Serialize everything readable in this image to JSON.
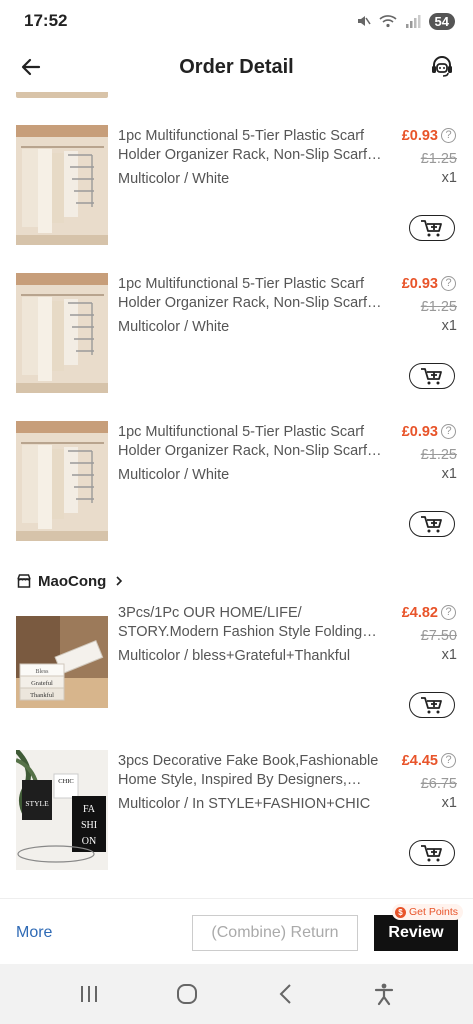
{
  "status_bar": {
    "time": "17:52",
    "battery": "54",
    "icons": [
      "mute-icon",
      "wifi-icon",
      "signal-icon"
    ]
  },
  "header": {
    "title": "Order Detail",
    "back_icon": "arrow-left-icon",
    "support_icon": "customer-service-icon"
  },
  "stores": [
    {
      "name": "MaoCong",
      "icon": "store-icon"
    }
  ],
  "items": [
    {
      "name": "1pc Multifunctional 5-Tier Plastic Scarf Holder Organizer Rack, Non-Slip Scarf Hanger",
      "variant": "Multicolor / White",
      "price": "£0.93",
      "original_price": "£1.25",
      "qty": "x1",
      "thumb": "scarf-rack"
    },
    {
      "name": "1pc Multifunctional 5-Tier Plastic Scarf Holder Organizer Rack, Non-Slip Scarf Hanger",
      "variant": "Multicolor / White",
      "price": "£0.93",
      "original_price": "£1.25",
      "qty": "x1",
      "thumb": "scarf-rack"
    },
    {
      "name": "1pc Multifunctional 5-Tier Plastic Scarf Holder Organizer Rack, Non-Slip Scarf Hanger",
      "variant": "Multicolor / White",
      "price": "£0.93",
      "original_price": "£1.25",
      "qty": "x1",
      "thumb": "scarf-rack"
    },
    {
      "name": "3Pcs/1Pc OUR HOME/LIFE/ STORY.Modern Fashion Style Folding Fake Book",
      "variant": "Multicolor / bless+Grateful+Thankful",
      "price": "£4.82",
      "original_price": "£7.50",
      "qty": "x1",
      "thumb": "books-grateful"
    },
    {
      "name": "3pcs Decorative Fake Book,Fashionable Home Style, Inspired By Designers, Hardcover",
      "variant": "Multicolor / In STYLE+FASHION+CHIC",
      "price": "£4.45",
      "original_price": "£6.75",
      "qty": "x1",
      "thumb": "books-fashion"
    }
  ],
  "thumb_text": {
    "grateful_1": "Bless",
    "grateful_2": "Grateful",
    "grateful_3": "Thankful",
    "fashion_1": "STYLE",
    "fashion_2": "CHIC",
    "fashion_3": "FA",
    "fashion_4": "SHI",
    "fashion_5": "ON"
  },
  "help_glyph": "?",
  "bottom_bar": {
    "more_label": "More",
    "return_label": "(Combine) Return",
    "review_label": "Review",
    "points_label": "Get Points"
  },
  "colors": {
    "accent_price": "#e8542a",
    "link": "#2f6ab5",
    "primary_button": "#111111"
  },
  "nav": [
    "recent-apps-icon",
    "home-icon",
    "back-icon",
    "accessibility-icon"
  ]
}
